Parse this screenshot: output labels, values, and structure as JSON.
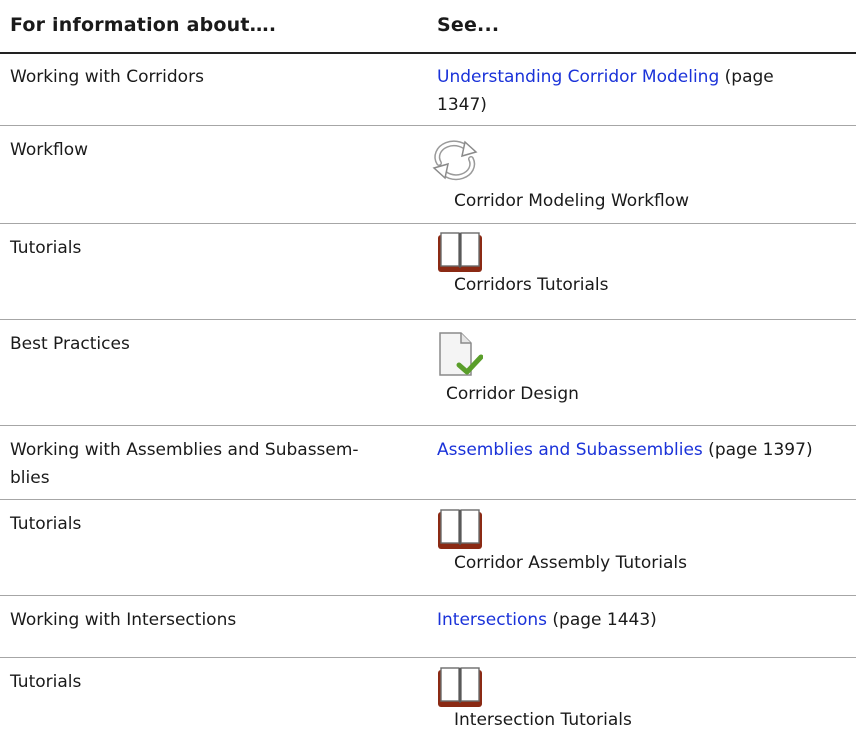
{
  "header": {
    "col1": "For information about….",
    "col2": "See..."
  },
  "rows": [
    {
      "topic": "Working with Corridors",
      "link": "Understanding Corridor Modeling",
      "after": " (page",
      "after2": "1347)"
    },
    {
      "topic": "Workflow",
      "icon": "workflow-cycle-icon",
      "label": "Corridor Modeling Workflow"
    },
    {
      "topic": "Tutorials",
      "icon": "book-icon",
      "label": "Corridors Tutorials"
    },
    {
      "topic": "Best Practices",
      "icon": "document-check-icon",
      "label": "Corridor Design"
    },
    {
      "topic": "Working with Assemblies and Subassem-",
      "topic2": "blies",
      "link": "Assemblies and Subassemblies",
      "after": " (page 1397)"
    },
    {
      "topic": "Tutorials",
      "icon": "book-icon",
      "label": "Corridor Assembly Tutorials"
    },
    {
      "topic": "Working with Intersections",
      "link": "Intersections",
      "after": " (page 1443)"
    },
    {
      "topic": "Tutorials",
      "icon": "book-icon",
      "label": "Intersection Tutorials"
    }
  ],
  "colors": {
    "link": "#1a32d9",
    "rule": "#a6a6a6",
    "book_cover": "#8b2a14"
  }
}
